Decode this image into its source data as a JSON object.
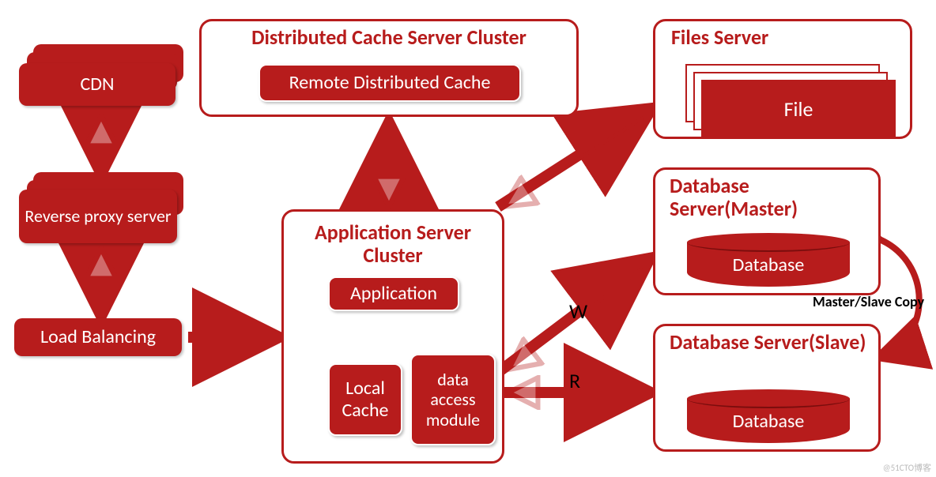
{
  "nodes": {
    "cdn": {
      "label": "CDN"
    },
    "reverse_proxy": {
      "label": "Reverse proxy server"
    },
    "load_balancing": {
      "label": "Load Balancing"
    },
    "dist_cache_cluster": {
      "title": "Distributed Cache Server Cluster",
      "child": "Remote Distributed Cache"
    },
    "app_cluster": {
      "title": "Application Server Cluster",
      "application": "Application",
      "local_cache": "Local Cache",
      "data_access": "data access module"
    },
    "files_server": {
      "title": "Files Server",
      "file": "File"
    },
    "db_master": {
      "title": "Database Server(Master)",
      "db": "Database"
    },
    "db_slave": {
      "title": "Database Server(Slave)",
      "db": "Database"
    }
  },
  "edges": {
    "w": "W",
    "r": "R",
    "replication": "Master/Slave Copy"
  },
  "watermark": "@51CTO博客"
}
